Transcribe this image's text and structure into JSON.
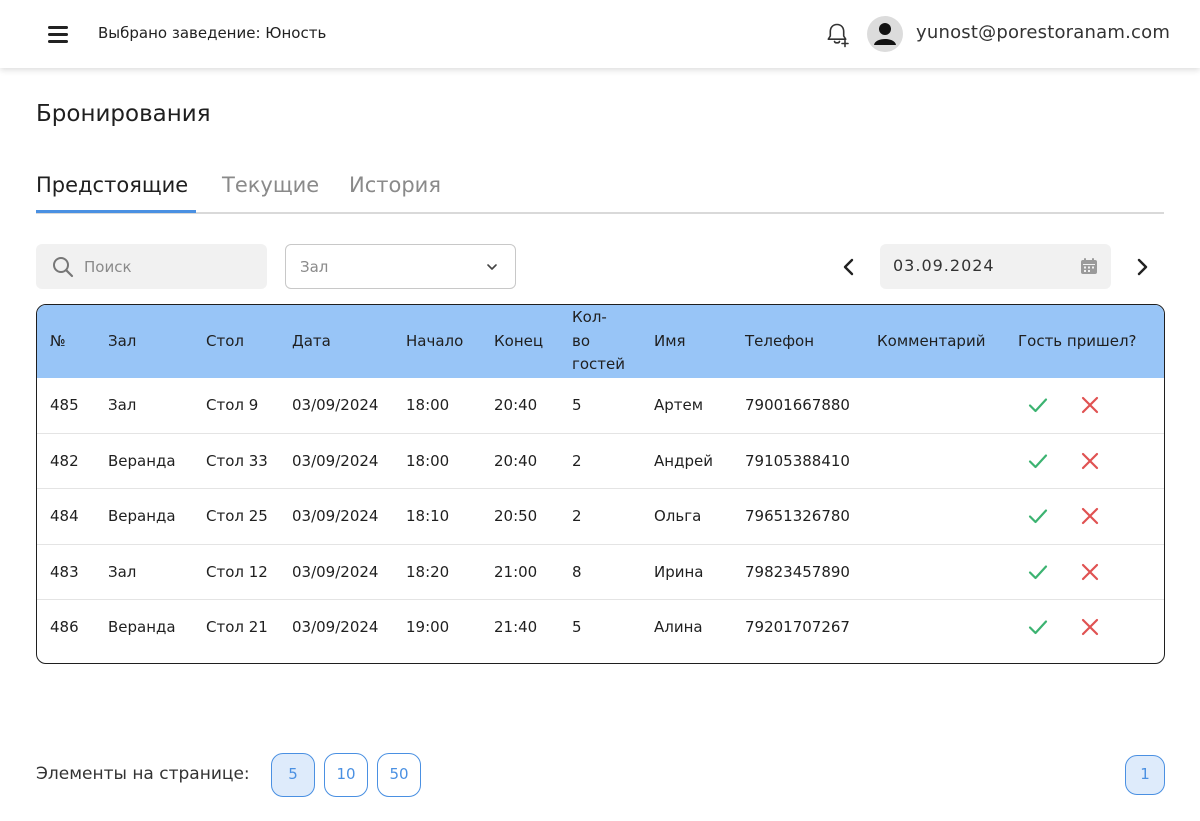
{
  "header": {
    "venue_label": "Выбрано заведение: Юность",
    "user_email": "yunost@porestoranam.com"
  },
  "page": {
    "title": "Бронирования"
  },
  "tabs": [
    {
      "label": "Предстоящие",
      "active": true
    },
    {
      "label": "Текущие",
      "active": false
    },
    {
      "label": "История",
      "active": false
    }
  ],
  "filters": {
    "search_placeholder": "Поиск",
    "hall_select_value": "Зал",
    "date_value": "03.09.2024"
  },
  "table": {
    "columns": [
      "№",
      "Зал",
      "Стол",
      "Дата",
      "Начало",
      "Конец",
      "Кол-во гостей",
      "Имя",
      "Телефон",
      "Комментарий",
      "Гость пришел?"
    ],
    "column_lines": {
      "guests": [
        "Кол-",
        "во",
        "гостей"
      ]
    },
    "rows": [
      {
        "num": "485",
        "hall": "Зал",
        "table": "Стол 9",
        "date": "03/09/2024",
        "start": "18:00",
        "end": "20:40",
        "guests": "5",
        "name": "Артем",
        "phone": "79001667880",
        "comment": ""
      },
      {
        "num": "482",
        "hall": "Веранда",
        "table": "Стол 33",
        "date": "03/09/2024",
        "start": "18:00",
        "end": "20:40",
        "guests": "2",
        "name": "Андрей",
        "phone": "79105388410",
        "comment": ""
      },
      {
        "num": "484",
        "hall": "Веранда",
        "table": "Стол 25",
        "date": "03/09/2024",
        "start": "18:10",
        "end": "20:50",
        "guests": "2",
        "name": "Ольга",
        "phone": "79651326780",
        "comment": ""
      },
      {
        "num": "483",
        "hall": "Зал",
        "table": "Стол 12",
        "date": "03/09/2024",
        "start": "18:20",
        "end": "21:00",
        "guests": "8",
        "name": "Ирина",
        "phone": "79823457890",
        "comment": ""
      },
      {
        "num": "486",
        "hall": "Веранда",
        "table": "Стол 21",
        "date": "03/09/2024",
        "start": "19:00",
        "end": "21:40",
        "guests": "5",
        "name": "Алина",
        "phone": "79201707267",
        "comment": ""
      }
    ]
  },
  "pagination": {
    "per_page_label": "Элементы на странице:",
    "per_page_options": [
      "5",
      "10",
      "50"
    ],
    "per_page_selected": "5",
    "pages": [
      "1"
    ],
    "current_page": "1"
  },
  "colors": {
    "accent": "#4a90e2",
    "table_header": "#98c5f7",
    "confirm": "#3cb371",
    "reject": "#e05252"
  },
  "icons": [
    "menu-icon",
    "bell-plus-icon",
    "user-avatar-icon",
    "search-icon",
    "chevron-down-icon",
    "chevron-left-icon",
    "calendar-icon",
    "chevron-right-icon",
    "check-icon",
    "close-icon"
  ]
}
